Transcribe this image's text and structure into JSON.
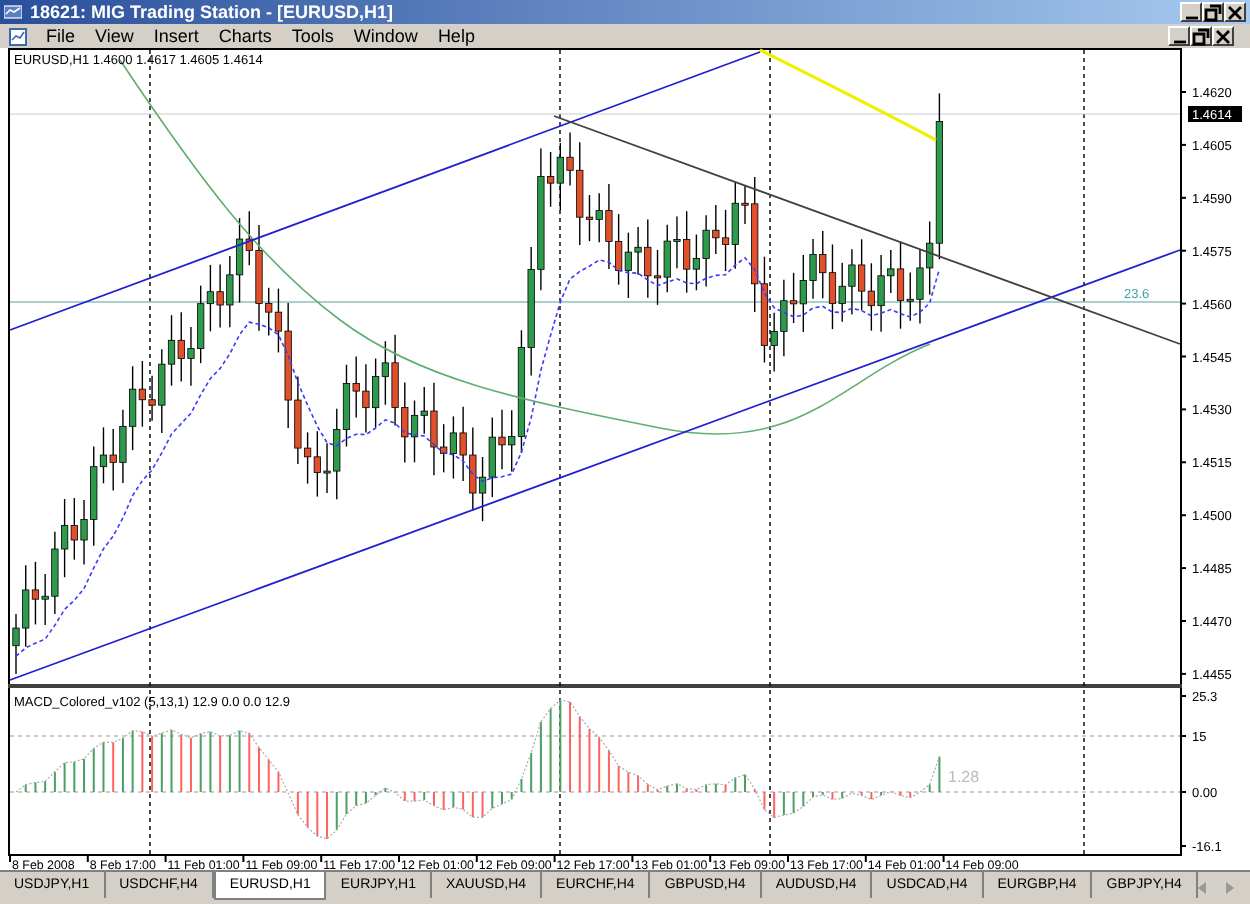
{
  "window": {
    "title": "18621: MIG Trading Station - [EURUSD,H1]"
  },
  "menu": [
    "File",
    "View",
    "Insert",
    "Charts",
    "Tools",
    "Window",
    "Help"
  ],
  "chart": {
    "info": "EURUSD,H1  1.4600 1.4617 1.4605 1.4614",
    "current_price": "1.4614",
    "fib_label": "23.6",
    "price_ticks": [
      "1.4620",
      "1.4605",
      "1.4590",
      "1.4575",
      "1.4560",
      "1.4545",
      "1.4530",
      "1.4515",
      "1.4500",
      "1.4485",
      "1.4470",
      "1.4455"
    ],
    "indicator": {
      "label": "MACD_Colored_v102 (5,13,1) 12.9 0.0 0.0 12.9",
      "value_label": "1.28",
      "ticks": [
        "25.3",
        "15",
        "0.00",
        "-16.1"
      ]
    },
    "time_ticks": [
      "8 Feb 2008",
      "8 Feb 17:00",
      "11 Feb 01:00",
      "11 Feb 09:00",
      "11 Feb 17:00",
      "12 Feb 01:00",
      "12 Feb 09:00",
      "12 Feb 17:00",
      "13 Feb 01:00",
      "13 Feb 09:00",
      "13 Feb 17:00",
      "14 Feb 01:00",
      "14 Feb 09:00"
    ]
  },
  "tabs": [
    {
      "label": "USDJPY,H1",
      "selected": false
    },
    {
      "label": "USDCHF,H4",
      "selected": false
    },
    {
      "label": "EURUSD,H1",
      "selected": true
    },
    {
      "label": "EURJPY,H1",
      "selected": false
    },
    {
      "label": "XAUUSD,H4",
      "selected": false
    },
    {
      "label": "EURCHF,H4",
      "selected": false
    },
    {
      "label": "GBPUSD,H4",
      "selected": false
    },
    {
      "label": "AUDUSD,H4",
      "selected": false
    },
    {
      "label": "USDCAD,H4",
      "selected": false
    },
    {
      "label": "EURGBP,H4",
      "selected": false
    },
    {
      "label": "GBPJPY,H4",
      "selected": false
    }
  ]
}
